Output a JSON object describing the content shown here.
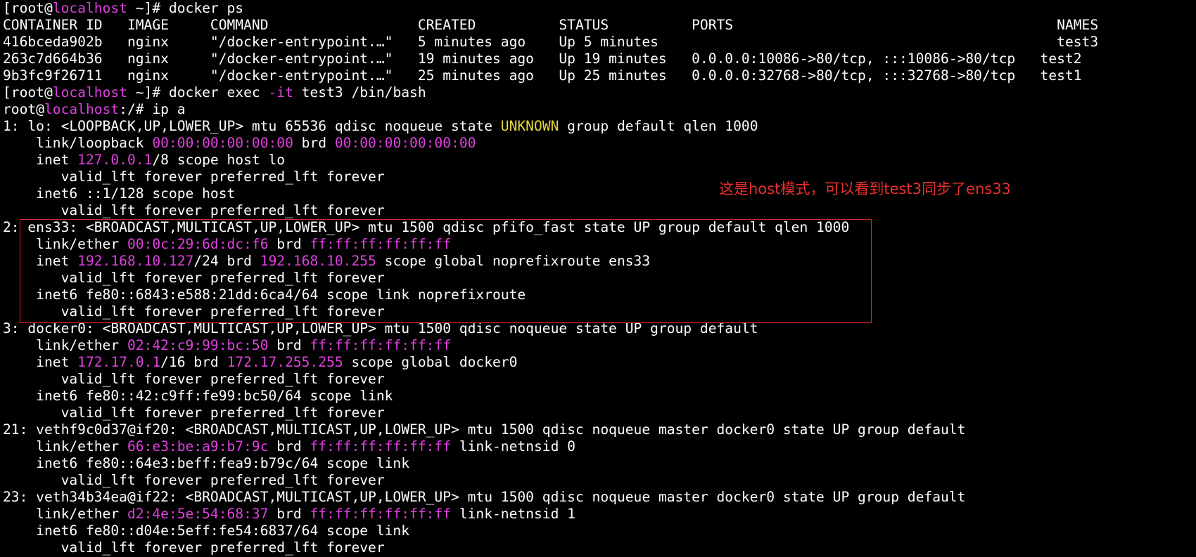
{
  "terminal": {
    "lines": [
      [
        [
          "[root@",
          ""
        ],
        [
          "localhost",
          "host"
        ],
        [
          " ~]# docker ps",
          ""
        ]
      ],
      [
        [
          "CONTAINER ID   IMAGE     COMMAND                  CREATED          STATUS          PORTS                                       NAMES",
          ""
        ]
      ],
      [
        [
          "416bceda902b   nginx     \"/docker-entrypoint.…\"   5 minutes ago    Up 5 minutes                                                test3",
          ""
        ]
      ],
      [
        [
          "263c7d664b36   nginx     \"/docker-entrypoint.…\"   19 minutes ago   Up 19 minutes   0.0.0.0:10086->80/tcp, :::10086->80/tcp   test2",
          ""
        ]
      ],
      [
        [
          "9b3fc9f26711   nginx     \"/docker-entrypoint.…\"   25 minutes ago   Up 25 minutes   0.0.0.0:32768->80/tcp, :::32768->80/tcp   test1",
          ""
        ]
      ],
      [
        [
          "[root@",
          ""
        ],
        [
          "localhost",
          "host"
        ],
        [
          " ~]# docker exec ",
          ""
        ],
        [
          "-it",
          "host"
        ],
        [
          " test3 /bin/bash",
          ""
        ]
      ],
      [
        [
          "root@",
          ""
        ],
        [
          "localhost",
          "host"
        ],
        [
          ":/# ip a",
          ""
        ]
      ],
      [
        [
          "1: lo: <LOOPBACK,UP,LOWER_UP> mtu 65536 qdisc noqueue state ",
          ""
        ],
        [
          "UNKNOWN",
          "unknown"
        ],
        [
          " group default qlen 1000",
          ""
        ]
      ],
      [
        [
          "    link/loopback ",
          ""
        ],
        [
          "00:00:00:00:00:00",
          "addr"
        ],
        [
          " brd ",
          ""
        ],
        [
          "00:00:00:00:00:00",
          "addr"
        ]
      ],
      [
        [
          "    inet ",
          ""
        ],
        [
          "127.0.0.1",
          "addr"
        ],
        [
          "/8 scope host lo",
          ""
        ]
      ],
      [
        [
          "       valid_lft forever preferred_lft forever",
          ""
        ]
      ],
      [
        [
          "    inet6 ::1/128 scope host",
          ""
        ]
      ],
      [
        [
          "       valid_lft forever preferred_lft forever",
          ""
        ]
      ],
      [
        [
          "2: ens33: <BROADCAST,MULTICAST,UP,LOWER_UP> mtu 1500 qdisc pfifo_fast state UP group default qlen 1000",
          ""
        ]
      ],
      [
        [
          "    link/ether ",
          ""
        ],
        [
          "00:0c:29:6d:dc:f6",
          "addr"
        ],
        [
          " brd ",
          ""
        ],
        [
          "ff:ff:ff:ff:ff:ff",
          "addr"
        ]
      ],
      [
        [
          "    inet ",
          ""
        ],
        [
          "192.168.10.127",
          "addr"
        ],
        [
          "/24 brd ",
          ""
        ],
        [
          "192.168.10.255",
          "addr"
        ],
        [
          " scope global noprefixroute ens33",
          ""
        ]
      ],
      [
        [
          "       valid_lft forever preferred_lft forever",
          ""
        ]
      ],
      [
        [
          "    inet6 fe80::6843:e588:21dd:6ca4/64 scope link noprefixroute",
          ""
        ]
      ],
      [
        [
          "       valid_lft forever preferred_lft forever",
          ""
        ]
      ],
      [
        [
          "3: docker0: <BROADCAST,MULTICAST,UP,LOWER_UP> mtu 1500 qdisc noqueue state UP group default",
          ""
        ]
      ],
      [
        [
          "    link/ether ",
          ""
        ],
        [
          "02:42:c9:99:bc:50",
          "addr"
        ],
        [
          " brd ",
          ""
        ],
        [
          "ff:ff:ff:ff:ff:ff",
          "addr"
        ]
      ],
      [
        [
          "    inet ",
          ""
        ],
        [
          "172.17.0.1",
          "addr"
        ],
        [
          "/16 brd ",
          ""
        ],
        [
          "172.17.255.255",
          "addr"
        ],
        [
          " scope global docker0",
          ""
        ]
      ],
      [
        [
          "       valid_lft forever preferred_lft forever",
          ""
        ]
      ],
      [
        [
          "    inet6 fe80::42:c9ff:fe99:bc50/64 scope link",
          ""
        ]
      ],
      [
        [
          "       valid_lft forever preferred_lft forever",
          ""
        ]
      ],
      [
        [
          "21: vethf9c0d37@if20: <BROADCAST,MULTICAST,UP,LOWER_UP> mtu 1500 qdisc noqueue master docker0 state UP group default",
          ""
        ]
      ],
      [
        [
          "    link/ether ",
          ""
        ],
        [
          "66:e3:be:a9:b7:9c",
          "addr"
        ],
        [
          " brd ",
          ""
        ],
        [
          "ff:ff:ff:ff:ff:ff",
          "addr"
        ],
        [
          " link-netnsid 0",
          ""
        ]
      ],
      [
        [
          "    inet6 fe80::64e3:beff:fea9:b79c/64 scope link",
          ""
        ]
      ],
      [
        [
          "       valid_lft forever preferred_lft forever",
          ""
        ]
      ],
      [
        [
          "23: veth34b34ea@if22: <BROADCAST,MULTICAST,UP,LOWER_UP> mtu 1500 qdisc noqueue master docker0 state UP group default",
          ""
        ]
      ],
      [
        [
          "    link/ether ",
          ""
        ],
        [
          "d2:4e:5e:54:68:37",
          "addr"
        ],
        [
          " brd ",
          ""
        ],
        [
          "ff:ff:ff:ff:ff:ff",
          "addr"
        ],
        [
          " link-netnsid 1",
          ""
        ]
      ],
      [
        [
          "    inet6 fe80::d04e:5eff:fe54:6837/64 scope link",
          ""
        ]
      ],
      [
        [
          "       valid_lft forever preferred_lft forever",
          ""
        ]
      ]
    ]
  },
  "annotation": {
    "text": "这是host模式，可以看到test3同步了ens33"
  },
  "colors": {
    "background": "#000000",
    "foreground": "#ffffff",
    "hostname_magenta": "#e040e0",
    "address_magenta": "#e040e0",
    "unknown_yellow": "#e6d73a",
    "highlight_red": "#d9262c",
    "annotation_red": "#e8302f"
  }
}
